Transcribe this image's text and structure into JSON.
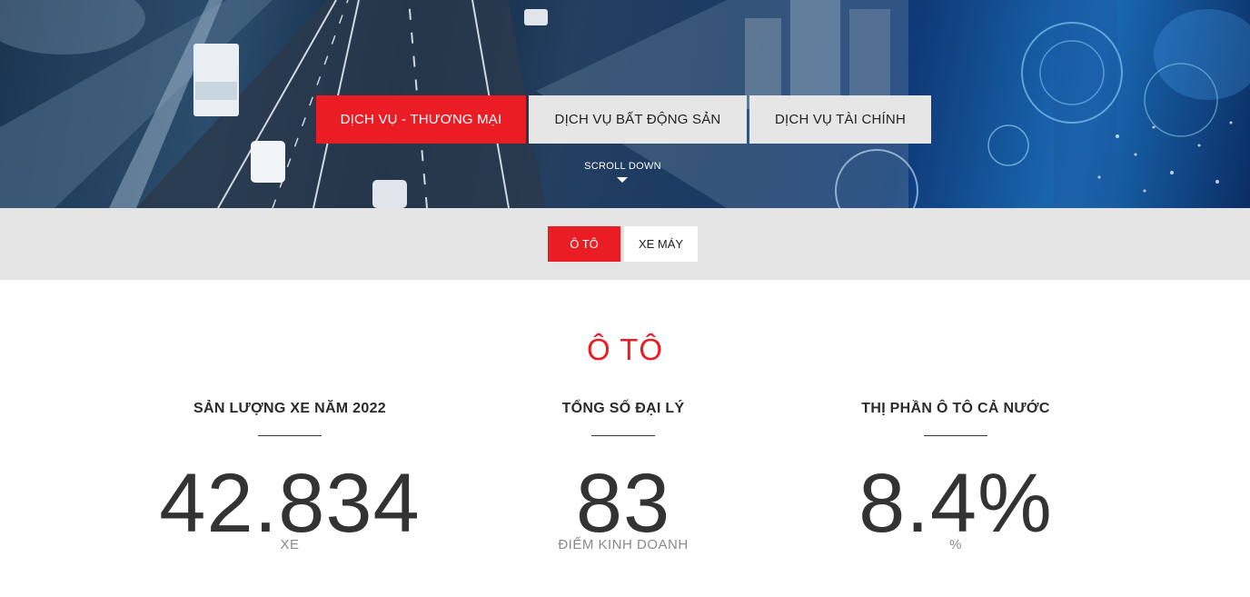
{
  "hero": {
    "tabs": [
      {
        "label": "DỊCH VỤ - THƯƠNG MẠI",
        "active": true
      },
      {
        "label": "DỊCH VỤ BẤT ĐỘNG SẢN",
        "active": false
      },
      {
        "label": "DỊCH VỤ TÀI CHÍNH",
        "active": false
      }
    ],
    "scroll_label": "SCROLL DOWN"
  },
  "subnav": {
    "items": [
      {
        "label": "Ô TÔ",
        "active": true
      },
      {
        "label": "XE MÁY",
        "active": false
      }
    ]
  },
  "section": {
    "title": "Ô TÔ",
    "stats": [
      {
        "label": "SẢN LƯỢNG XE NĂM 2022",
        "value": "42.834",
        "unit": "XE"
      },
      {
        "label": "TỔNG SỐ ĐẠI LÝ",
        "value": "83",
        "unit": "ĐIỂM KINH DOANH"
      },
      {
        "label": "THỊ PHẦN Ô TÔ CẢ NƯỚC",
        "value": "8.4%",
        "unit": "%"
      }
    ]
  },
  "colors": {
    "accent": "#ea1c24",
    "tab_inactive": "#e6e6e6",
    "subnav_bg": "#e4e4e4",
    "stat_text": "#333333"
  }
}
